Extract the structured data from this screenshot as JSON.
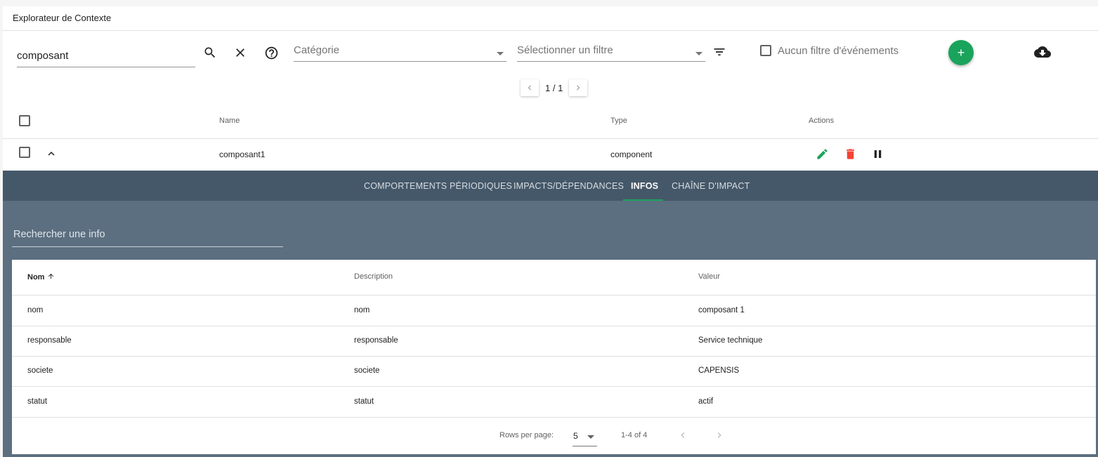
{
  "window": {
    "title": "Explorateur de Contexte"
  },
  "toolbar": {
    "search_value": "composant",
    "category_placeholder": "Catégorie",
    "filter_placeholder": "Sélectionner un filtre",
    "event_filter_label": "Aucun filtre d'événements",
    "add_label": "+"
  },
  "pagination": {
    "text": "1 / 1"
  },
  "table": {
    "headers": {
      "name": "Name",
      "type": "Type",
      "actions": "Actions"
    },
    "rows": [
      {
        "name": "composant1",
        "type": "component",
        "expanded": true
      }
    ]
  },
  "details": {
    "tabs": [
      {
        "label": "COMPORTEMENTS PÉRIODIQUES",
        "active": false
      },
      {
        "label": "IMPACTS/DÉPENDANCES",
        "active": false
      },
      {
        "label": "INFOS",
        "active": true
      },
      {
        "label": "CHAÎNE D'IMPACT",
        "active": false
      }
    ],
    "info_search_placeholder": "Rechercher une info",
    "info_table": {
      "headers": {
        "name": "Nom",
        "description": "Description",
        "value": "Valeur"
      },
      "sort": {
        "column": "Nom",
        "direction": "ascending",
        "icon": "arrow-up-icon"
      },
      "rows": [
        {
          "name": "nom",
          "description": "nom",
          "value": "composant 1"
        },
        {
          "name": "responsable",
          "description": "responsable",
          "value": "Service technique"
        },
        {
          "name": "societe",
          "description": "societe",
          "value": "CAPENSIS"
        },
        {
          "name": "statut",
          "description": "statut",
          "value": "actif"
        }
      ],
      "footer": {
        "rows_per_page_label": "Rows per page:",
        "rows_per_page": "5",
        "range": "1-4 of 4"
      }
    }
  },
  "colors": {
    "accent": "#1aa35b",
    "danger": "#f44336",
    "tabs_bar": "#455869",
    "expanded_bg": "#5c6f80"
  }
}
